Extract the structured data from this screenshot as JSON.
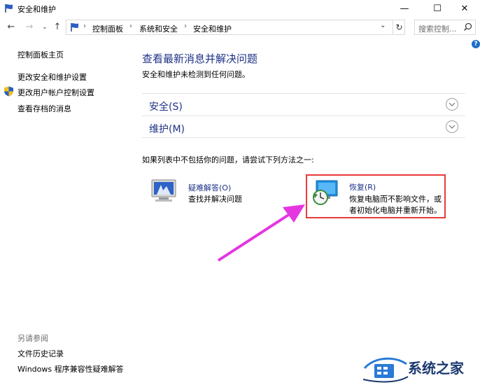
{
  "window": {
    "title": "安全和维护",
    "minimize": "—",
    "maximize": "☐",
    "close": "✕"
  },
  "nav": {
    "back": "←",
    "forward": "→",
    "recent": "⌄",
    "up": "↑",
    "refresh": "↻",
    "dropdown": "⌄",
    "breadcrumbs": [
      "控制面板",
      "系统和安全",
      "安全和维护"
    ],
    "separator": "›",
    "search_placeholder": "搜索控制..."
  },
  "help": "?",
  "sidebar": {
    "items": [
      {
        "label": "控制面板主页"
      },
      {
        "label": "更改安全和维护设置"
      },
      {
        "label": "更改用户帐户控制设置"
      },
      {
        "label": "查看存档的消息"
      }
    ],
    "see_also_title": "另请参阅",
    "see_also": [
      {
        "label": "文件历史记录"
      },
      {
        "label": "Windows 程序兼容性疑难解答"
      }
    ]
  },
  "main": {
    "heading": "查看最新消息并解决问题",
    "subtext": "安全和维护未检测到任何问题。",
    "sections": [
      {
        "label": "安全(S)"
      },
      {
        "label": "维护(M)"
      }
    ],
    "try_text": "如果列表中不包括你的问题，请尝试下列方法之一:",
    "options": [
      {
        "title": "疑难解答(O)",
        "desc": "查找并解决问题"
      },
      {
        "title": "恢复(R)",
        "desc_line1": "恢复电脑而不影响文件，或",
        "desc_line2": "者初始化电脑并重新开始。"
      }
    ]
  },
  "watermark": {
    "text": "系统之家"
  },
  "colors": {
    "link_blue": "#1e3287",
    "highlight_red": "#e83a3a",
    "arrow_magenta": "#e536e0"
  }
}
